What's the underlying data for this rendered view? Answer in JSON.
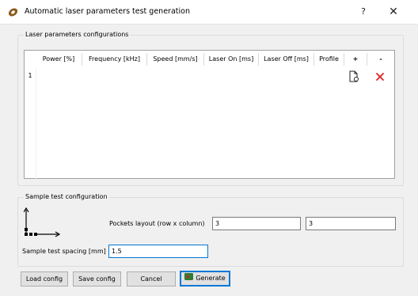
{
  "window": {
    "title": "Automatic laser parameters test generation",
    "help_label": "?",
    "close_label": "✕",
    "icon": "laser-app-icon"
  },
  "laser_group": {
    "title": "Laser parameters configurations",
    "columns": [
      "Power [%]",
      "Frequency [kHz]",
      "Speed [mm/s]",
      "Laser On [ms]",
      "Laser Off [ms]",
      "Profile",
      "+",
      "-"
    ],
    "rows": [
      {
        "header": "1",
        "actions": [
          "new-file-icon",
          "delete-x-icon"
        ]
      }
    ]
  },
  "sample_group": {
    "title": "Sample test configuration",
    "layout_icon": "grid-axes-icon",
    "pockets_label": "Pockets layout (row x column)",
    "rows_value": "3",
    "columns_value": "3",
    "spacing_label": "Sample test spacing [mm]",
    "spacing_value": "1.5"
  },
  "footer": {
    "load_label": "Load config",
    "save_label": "Save config",
    "cancel_label": "Cancel",
    "generate_label": "Generate",
    "generate_icon": "generate-icon"
  },
  "colors": {
    "accent": "#0078d7",
    "delete": "#e02020",
    "generate_icon": "#2e7d32"
  }
}
